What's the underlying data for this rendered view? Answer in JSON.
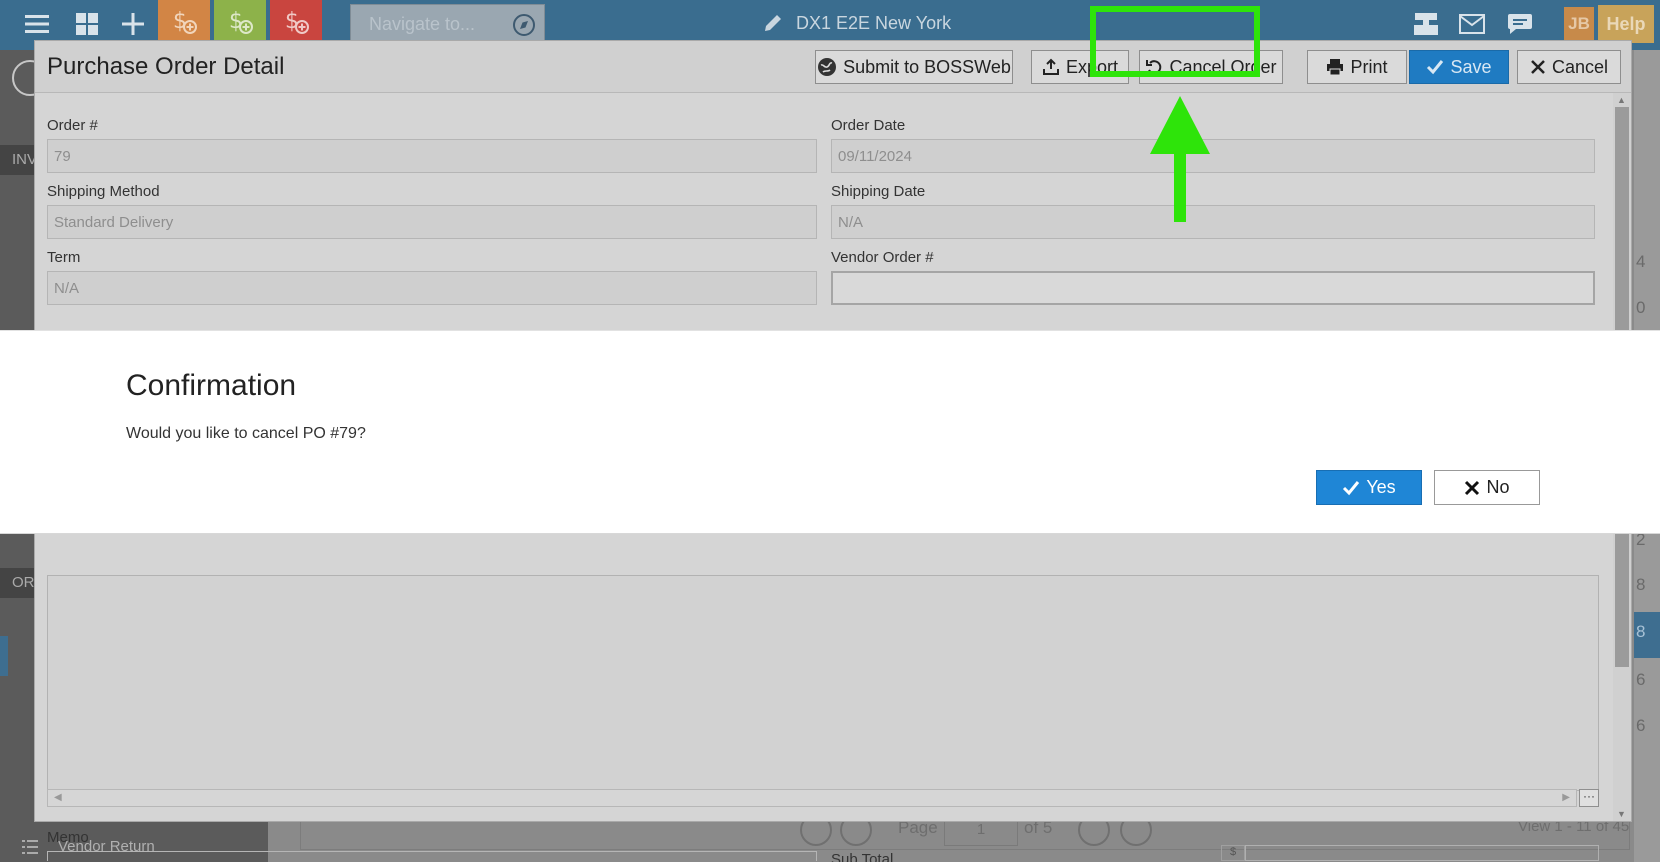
{
  "topbar": {
    "nav_placeholder": "Navigate to...",
    "store_name": "DX1 E2E New York",
    "user_initials": "JB",
    "help_label": "Help",
    "tile_colors": [
      "#d28545",
      "#8db24a",
      "#c9453f"
    ]
  },
  "sidebar": {
    "section1_short": "INV",
    "section2_short": "OR",
    "vendor_return_label": "Vendor Return"
  },
  "background_grid": {
    "cells": [
      "4",
      "0",
      "2",
      "8",
      "8",
      "6",
      "6"
    ],
    "pager_page_label": "Page",
    "pager_page_value": "1",
    "pager_of": "of 5",
    "pager_view": "View 1 - 11 of 45"
  },
  "po_modal": {
    "title": "Purchase Order Detail",
    "buttons": {
      "submit": "Submit to BOSSWeb",
      "export": "Export",
      "cancel_order": "Cancel Order",
      "print": "Print",
      "save": "Save",
      "cancel": "Cancel"
    },
    "fields": {
      "order_no_label": "Order #",
      "order_no_value": "79",
      "order_date_label": "Order Date",
      "order_date_value": "09/11/2024",
      "shipping_method_label": "Shipping Method",
      "shipping_method_value": "Standard Delivery",
      "shipping_date_label": "Shipping Date",
      "shipping_date_value": "N/A",
      "term_label": "Term",
      "term_value": "N/A",
      "vendor_order_label": "Vendor Order #",
      "vendor_order_value": ""
    },
    "memo_label": "Memo",
    "subtotal_label": "Sub Total",
    "currency_symbol": "$",
    "more_label": "···"
  },
  "confirmation": {
    "title": "Confirmation",
    "message": "Would you like to cancel PO #79?",
    "yes_label": "Yes",
    "no_label": "No"
  },
  "annotation": {
    "highlight_color": "#2ee40a"
  }
}
